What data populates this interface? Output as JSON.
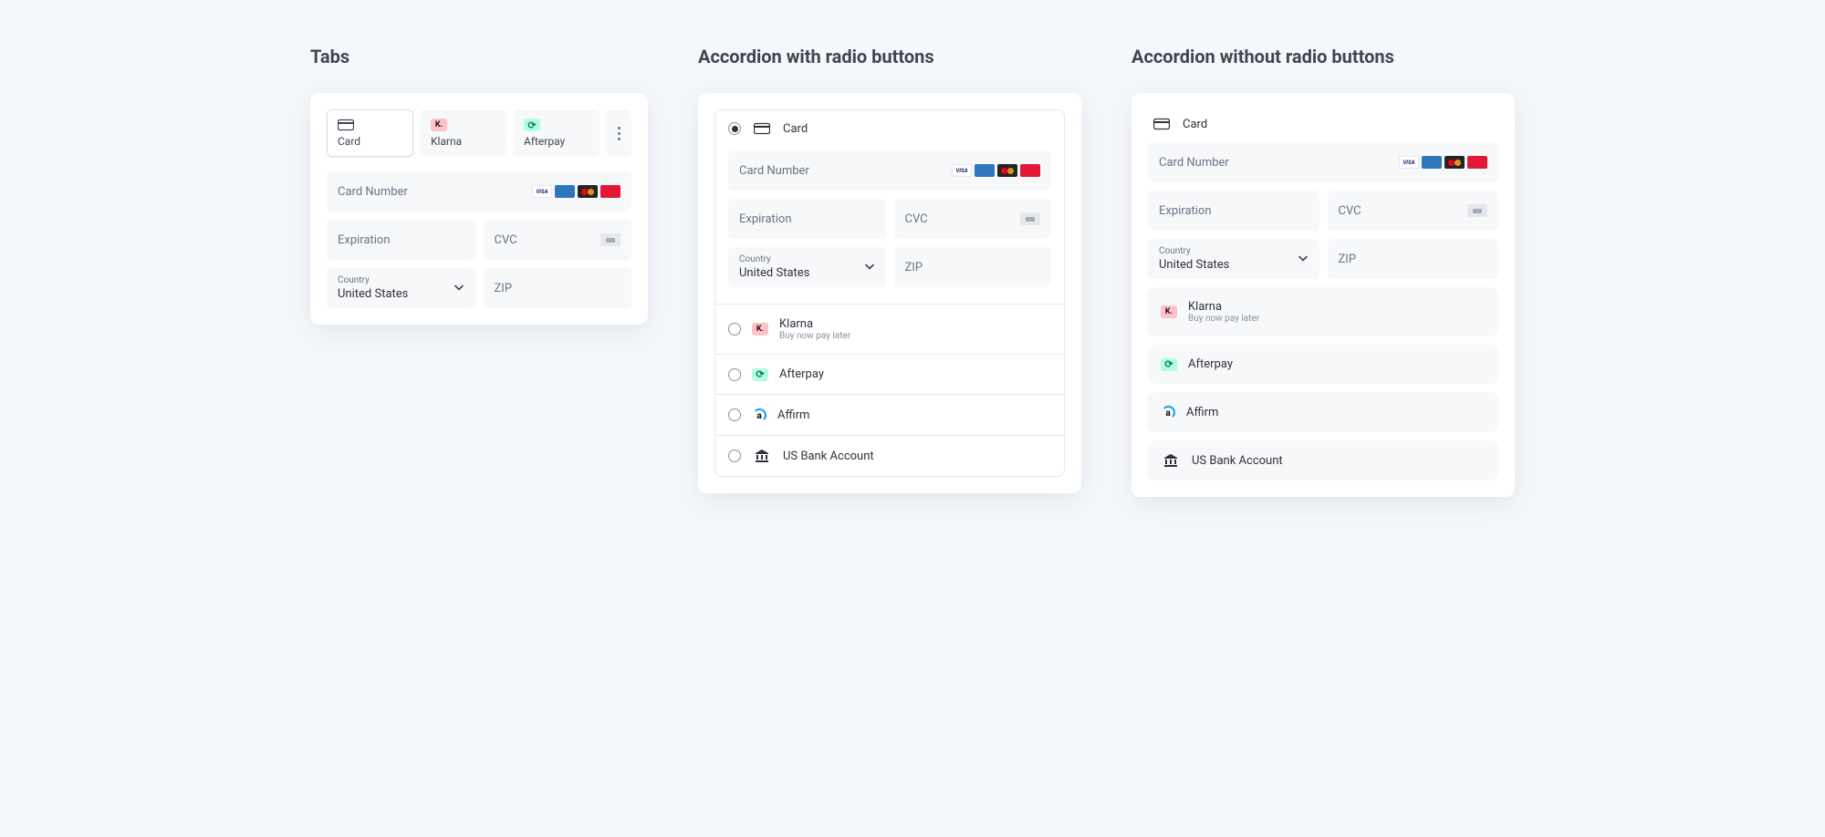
{
  "sections": {
    "tabs": "Tabs",
    "accRadio": "Accordion with radio buttons",
    "accNoRadio": "Accordion without radio buttons"
  },
  "payment": {
    "card": "Card",
    "klarna": "Klarna",
    "klarnaSub": "Buy now pay later",
    "afterpay": "Afterpay",
    "affirm": "Affirm",
    "usbank": "US Bank Account"
  },
  "fields": {
    "cardNumber": "Card Number",
    "expiration": "Expiration",
    "cvc": "CVC",
    "countryLabel": "Country",
    "countryValue": "United States",
    "zip": "ZIP"
  },
  "icons": {
    "klarnaK": "K."
  }
}
